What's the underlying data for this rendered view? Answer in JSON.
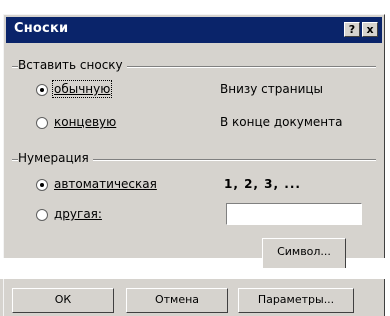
{
  "window": {
    "title": "Сноски",
    "help_label": "?",
    "close_label": "x"
  },
  "insert_group": {
    "label": "Вставить сноску",
    "options": [
      {
        "label": "обычную",
        "description": "Внизу страницы",
        "selected": true
      },
      {
        "label": "концевую",
        "description": "В конце документа",
        "selected": false
      }
    ]
  },
  "numbering_group": {
    "label": "Нумерация",
    "options": [
      {
        "label": "автоматическая",
        "description": "1, 2, 3, ...",
        "selected": true
      },
      {
        "label": "другая:",
        "value": "",
        "selected": false
      }
    ]
  },
  "buttons": {
    "symbol_label": "Символ...",
    "ok_label": "ОК",
    "cancel_label": "Отмена",
    "options_label": "Параметры..."
  },
  "colors": {
    "title_bar": "#0a246a",
    "dialog_bg": "#d6d3ce"
  }
}
